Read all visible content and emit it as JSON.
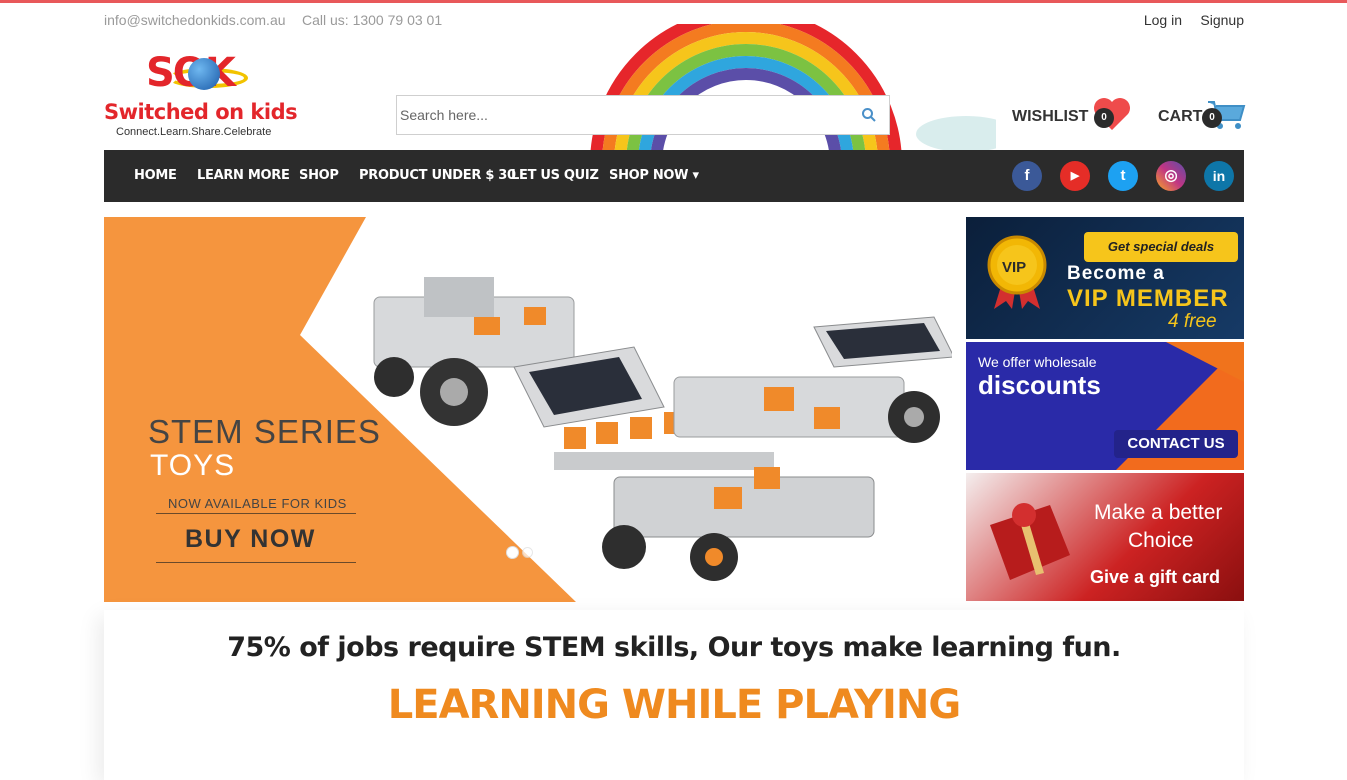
{
  "topbar": {
    "email": "info@switchedonkids.com.au",
    "phone": "Call us: 1300 79 03 01",
    "login": "Log in",
    "signup": "Signup"
  },
  "logo": {
    "letters": "SOK",
    "name": "Switched on kids",
    "tagline": "Connect.Learn.Share.Celebrate"
  },
  "search": {
    "placeholder": "Search here...",
    "icon": "search-icon"
  },
  "wishlist": {
    "label": "WISHLIST",
    "count": "0",
    "icon": "heart-icon"
  },
  "cart": {
    "label": "CART",
    "count": "0",
    "icon": "cart-icon"
  },
  "nav": {
    "items": [
      {
        "label": "HOME"
      },
      {
        "label": "LEARN MORE"
      },
      {
        "label": "SHOP"
      },
      {
        "label": "PRODUCT UNDER $ 30"
      },
      {
        "label": "LET US QUIZ"
      },
      {
        "label": "SHOP NOW ▾"
      }
    ],
    "social": [
      {
        "name": "facebook",
        "glyph": "f",
        "color": "#3b5998"
      },
      {
        "name": "youtube",
        "glyph": "▶",
        "color": "#e52d27"
      },
      {
        "name": "twitter",
        "glyph": "t",
        "color": "#1da1f2"
      },
      {
        "name": "instagram",
        "glyph": "◎",
        "color": "#c13584"
      },
      {
        "name": "linkedin",
        "glyph": "in",
        "color": "#0e76a8"
      }
    ]
  },
  "hero": {
    "title_line1": "STEM SERIES",
    "title_line2": "TOYS",
    "subtitle": "NOW AVAILABLE FOR KIDS",
    "cta": "BUY NOW",
    "accent_color": "#f5953e"
  },
  "banners": {
    "vip": {
      "badge": "Get special deals",
      "medal_text": "VIP",
      "line1": "Become a",
      "line2": "VIP MEMBER",
      "line3": "4 free"
    },
    "wholesale": {
      "line1": "We offer wholesale",
      "line2": "discounts",
      "cta": "CONTACT US"
    },
    "gift": {
      "line1": "Make a better",
      "line2": "Choice",
      "line3": "Give a gift card"
    }
  },
  "tagline": {
    "stem": "75% of jobs require STEM skills, Our toys make learning fun.",
    "headline": "LEARNING WHILE PLAYING"
  }
}
